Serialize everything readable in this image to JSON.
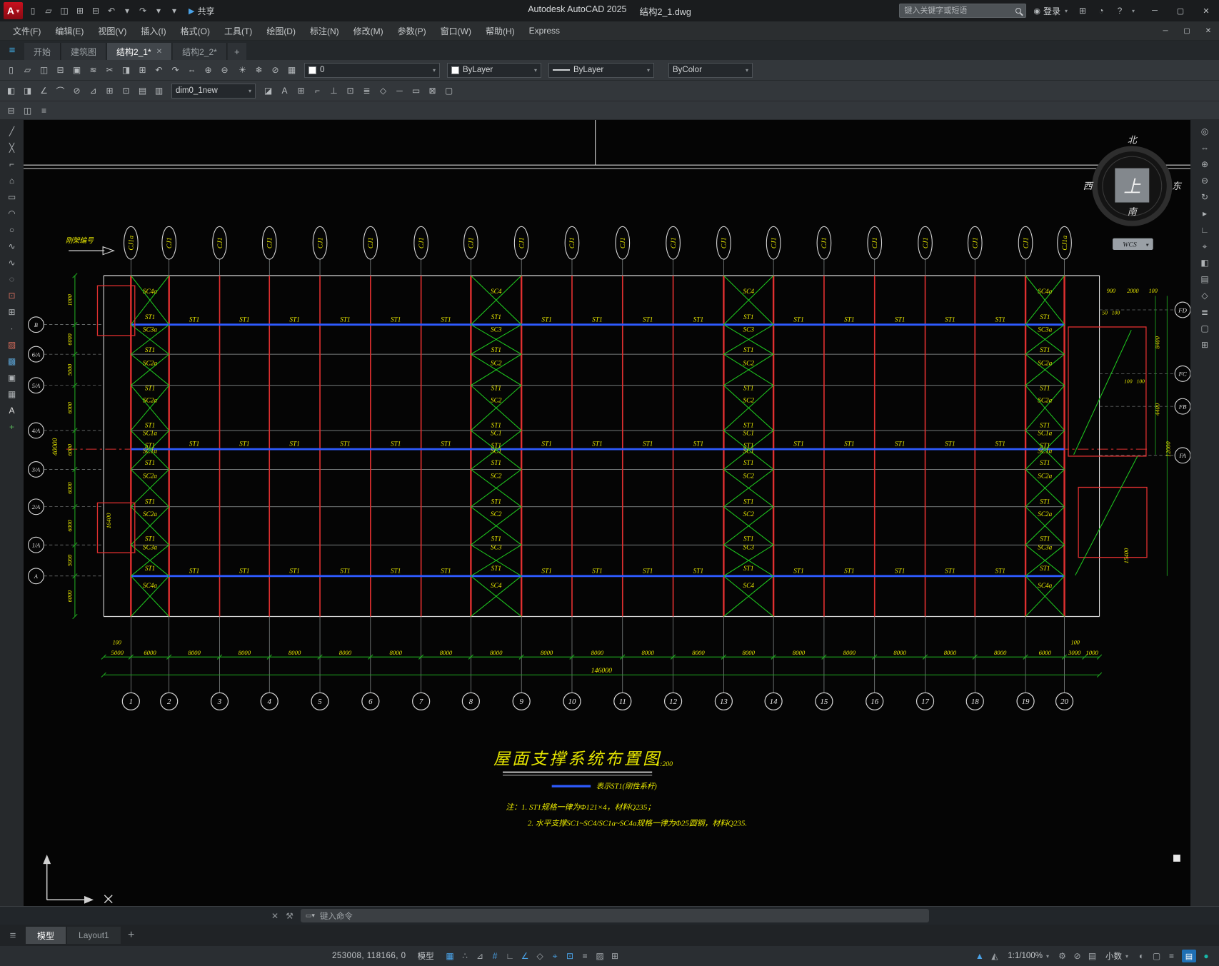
{
  "titlebar": {
    "logo": "A",
    "app_title": "Autodesk AutoCAD 2025",
    "doc_title": "结构2_1.dwg",
    "share_label": "共享",
    "search_placeholder": "键入关键字或短语",
    "login_label": "登录",
    "qat_icons": [
      {
        "name": "new-drawing-icon",
        "glyph": "▯"
      },
      {
        "name": "open-icon",
        "glyph": "▱"
      },
      {
        "name": "save-icon",
        "glyph": "◫"
      },
      {
        "name": "save-as-icon",
        "glyph": "⊞"
      },
      {
        "name": "plot-icon",
        "glyph": "⊟"
      },
      {
        "name": "undo-icon",
        "glyph": "↶"
      },
      {
        "name": "undo-dropdown-icon",
        "glyph": "▾"
      },
      {
        "name": "redo-icon",
        "glyph": "↷"
      },
      {
        "name": "redo-dropdown-icon",
        "glyph": "▾"
      },
      {
        "name": "qat-customize-icon",
        "glyph": "▾"
      }
    ]
  },
  "menubar": {
    "items": [
      "文件(F)",
      "编辑(E)",
      "视图(V)",
      "插入(I)",
      "格式(O)",
      "工具(T)",
      "绘图(D)",
      "标注(N)",
      "修改(M)",
      "参数(P)",
      "窗口(W)",
      "帮助(H)",
      "Express"
    ]
  },
  "filetabs": {
    "items": [
      {
        "label": "开始",
        "active": false
      },
      {
        "label": "建筑图",
        "active": false
      },
      {
        "label": "结构2_1*",
        "active": true,
        "closable": true
      },
      {
        "label": "结构2_2*",
        "active": false
      }
    ],
    "new_tab": "+"
  },
  "ribbon": {
    "layer_value": "0",
    "color_value": "ByLayer",
    "linetype_value": "ByLayer",
    "plotstyle_value": "ByColor",
    "dimstyle_value": "dim0_1new",
    "row1_icons_a": [
      {
        "name": "new-icon",
        "glyph": "▯"
      },
      {
        "name": "open-icon",
        "glyph": "▱"
      },
      {
        "name": "save-icon",
        "glyph": "◫"
      },
      {
        "name": "plot-icon",
        "glyph": "⊟"
      },
      {
        "name": "publish-icon",
        "glyph": "▣"
      },
      {
        "name": "match-properties-icon",
        "glyph": "≋"
      },
      {
        "name": "cut-icon",
        "glyph": "✂"
      },
      {
        "name": "copy-clip-icon",
        "glyph": "◨"
      },
      {
        "name": "paste-icon",
        "glyph": "⊞"
      },
      {
        "name": "undo-icon",
        "glyph": "↶"
      },
      {
        "name": "redo-icon",
        "glyph": "↷"
      },
      {
        "name": "pan-icon",
        "glyph": "⇔"
      },
      {
        "name": "zoom-in-icon",
        "glyph": "⊕"
      },
      {
        "name": "zoom-out-icon",
        "glyph": "⊖"
      }
    ],
    "row1_icons_b": [
      {
        "name": "layer-on-icon",
        "glyph": "☀"
      },
      {
        "name": "layer-freeze-icon",
        "glyph": "❄"
      },
      {
        "name": "layer-lock-icon",
        "glyph": "⊘"
      },
      {
        "name": "layer-properties-icon",
        "glyph": "▦"
      }
    ],
    "row2_icons_a": [
      {
        "name": "dim-linear-icon",
        "glyph": "◧"
      },
      {
        "name": "dim-aligned-icon",
        "glyph": "◨"
      },
      {
        "name": "dim-angular-icon",
        "glyph": "∠"
      },
      {
        "name": "dim-radius-icon",
        "glyph": "⌒"
      },
      {
        "name": "dim-diameter-icon",
        "glyph": "⊘"
      },
      {
        "name": "leader-icon",
        "glyph": "⊿"
      },
      {
        "name": "tolerance-icon",
        "glyph": "⊞"
      },
      {
        "name": "center-mark-icon",
        "glyph": "⊡"
      },
      {
        "name": "dim-edit-icon",
        "glyph": "▤"
      },
      {
        "name": "dim-update-icon",
        "glyph": "▥"
      }
    ],
    "row2_icons_b": [
      {
        "name": "dim-style-icon",
        "glyph": "◪"
      },
      {
        "name": "text-style-icon",
        "glyph": "A"
      },
      {
        "name": "table-icon",
        "glyph": "⊞"
      },
      {
        "name": "mleader-icon",
        "glyph": "⌐"
      },
      {
        "name": "ortho-icon",
        "glyph": "⊥"
      },
      {
        "name": "osnap-icon",
        "glyph": "⊡"
      },
      {
        "name": "layers-icon",
        "glyph": "≣"
      },
      {
        "name": "group-icon",
        "glyph": "◇"
      },
      {
        "name": "measure-icon",
        "glyph": "─"
      },
      {
        "name": "properties-icon",
        "glyph": "▭"
      },
      {
        "name": "blocks-icon",
        "glyph": "⊠"
      },
      {
        "name": "tool-palettes-icon",
        "glyph": "▢"
      }
    ],
    "row3_icons": [
      {
        "name": "layer-walk-icon",
        "glyph": "⊟"
      },
      {
        "name": "layer-merge-icon",
        "glyph": "◫"
      },
      {
        "name": "layer-translate-icon",
        "glyph": "≡"
      }
    ]
  },
  "left_toolbar": [
    {
      "name": "line-tool-icon",
      "glyph": "╱"
    },
    {
      "name": "construction-line-tool-icon",
      "glyph": "╳"
    },
    {
      "name": "polyline-tool-icon",
      "glyph": "⌐"
    },
    {
      "name": "polygon-tool-icon",
      "glyph": "⌂"
    },
    {
      "name": "rectangle-tool-icon",
      "glyph": "▭"
    },
    {
      "name": "arc-tool-icon",
      "glyph": "◠"
    },
    {
      "name": "circle-tool-icon",
      "glyph": "○"
    },
    {
      "name": "revision-cloud-tool-icon",
      "glyph": "∿"
    },
    {
      "name": "spline-tool-icon",
      "glyph": "∿"
    },
    {
      "name": "ellipse-tool-icon",
      "glyph": "◌"
    },
    {
      "name": "insert-block-tool-icon",
      "glyph": "⊡",
      "color": "#c86a5a"
    },
    {
      "name": "make-block-tool-icon",
      "glyph": "⊞"
    },
    {
      "name": "point-tool-icon",
      "glyph": "∙"
    },
    {
      "name": "hatch-tool-icon",
      "glyph": "▨",
      "color": "#d06a5a"
    },
    {
      "name": "gradient-tool-icon",
      "glyph": "▩",
      "color": "#5aa0d0"
    },
    {
      "name": "region-tool-icon",
      "glyph": "▣"
    },
    {
      "name": "table-tool-icon",
      "glyph": "▦"
    },
    {
      "name": "multiline-text-tool-icon",
      "glyph": "A",
      "color": "#e0e0e0"
    },
    {
      "name": "add-selected-tool-icon",
      "glyph": "+",
      "color": "#58b058"
    }
  ],
  "right_toolbar": [
    {
      "name": "navigation-wheel-icon",
      "glyph": "◎"
    },
    {
      "name": "pan-icon",
      "glyph": "⇔"
    },
    {
      "name": "zoom-extents-icon",
      "glyph": "⊕"
    },
    {
      "name": "zoom-window-icon",
      "glyph": "⊖"
    },
    {
      "name": "orbit-icon",
      "glyph": "↻"
    },
    {
      "name": "showmotion-icon",
      "glyph": "▸"
    },
    {
      "name": "ucs-icon",
      "glyph": "∟"
    },
    {
      "name": "measure-icon",
      "glyph": "⌖"
    },
    {
      "name": "section-icon",
      "glyph": "◧"
    },
    {
      "name": "view-manager-icon",
      "glyph": "▤"
    },
    {
      "name": "visual-style-icon",
      "glyph": "◇"
    },
    {
      "name": "layers-panel-icon",
      "glyph": "≣"
    },
    {
      "name": "properties-panel-icon",
      "glyph": "▢"
    },
    {
      "name": "sheet-set-icon",
      "glyph": "⊞"
    }
  ],
  "cmdbar": {
    "history_chip": "▭▾",
    "placeholder": "键入命令",
    "close_glyph": "✕",
    "tools_glyph": "⚒"
  },
  "doctabs": {
    "items": [
      {
        "label": "模型",
        "active": true
      },
      {
        "label": "Layout1",
        "active": false
      }
    ],
    "new_tab": "+"
  },
  "statusbar": {
    "coords": "253008, 118166, 0",
    "model_label": "模型",
    "scale_label": "1:1/100%",
    "units_label": "小数",
    "left_icons": [
      {
        "name": "grid-icon",
        "glyph": "▦",
        "active": true
      },
      {
        "name": "snap-mode-icon",
        "glyph": "∴"
      },
      {
        "name": "infer-constraints-icon",
        "glyph": "⊿"
      },
      {
        "name": "dynamic-input-icon",
        "glyph": "#",
        "active": true
      },
      {
        "name": "ortho-mode-icon",
        "glyph": "∟"
      },
      {
        "name": "polar-tracking-icon",
        "glyph": "∠",
        "active": true
      },
      {
        "name": "isometric-drafting-icon",
        "glyph": "◇"
      },
      {
        "name": "object-snap-tracking-icon",
        "glyph": "⌖",
        "active": true
      },
      {
        "name": "object-snap-icon",
        "glyph": "⊡",
        "active": true
      },
      {
        "name": "lineweight-icon",
        "glyph": "≡"
      },
      {
        "name": "transparency-icon",
        "glyph": "▨"
      },
      {
        "name": "selection-cycling-icon",
        "glyph": "⊞"
      }
    ],
    "right_icons_a": [
      {
        "name": "annotation-visibility-icon",
        "glyph": "▲",
        "active": true
      },
      {
        "name": "autoscale-icon",
        "glyph": "◭"
      }
    ],
    "right_icons_b": [
      {
        "name": "workspace-switching-icon",
        "glyph": "⚙"
      },
      {
        "name": "annotation-monitor-icon",
        "glyph": "⊘"
      },
      {
        "name": "quick-properties-icon",
        "glyph": "▤"
      }
    ],
    "right_icons_c": [
      {
        "name": "graphics-performance-icon",
        "glyph": "◐"
      },
      {
        "name": "clean-screen-icon",
        "glyph": "▢"
      },
      {
        "name": "customization-icon",
        "glyph": "≡"
      }
    ]
  },
  "drawing": {
    "frame_note": "刚架编号",
    "cj_labels": [
      "CJ1a",
      "CJ1",
      "CJ1",
      "CJ1",
      "CJ1",
      "CJ1",
      "CJ1",
      "CJ1",
      "CJ1",
      "CJ1",
      "CJ1",
      "CJ1",
      "CJ1",
      "CJ1",
      "CJ1",
      "CJ1",
      "CJ1",
      "CJ1",
      "CJ1",
      "CJ1a"
    ],
    "columns": [
      "1",
      "2",
      "3",
      "4",
      "5",
      "6",
      "7",
      "8",
      "9",
      "10",
      "11",
      "12",
      "13",
      "14",
      "15",
      "16",
      "17",
      "18",
      "19",
      "20"
    ],
    "row_bubbles": [
      "B",
      "6/A",
      "5/A",
      "4/A",
      "3/A",
      "2/A",
      "1/A",
      "A"
    ],
    "bottom_dims": [
      "5000",
      "6000",
      "8000",
      "8000",
      "8000",
      "8000",
      "8000",
      "8000",
      "8000",
      "8000",
      "8000",
      "8000",
      "8000",
      "8000",
      "8000",
      "8000",
      "8000",
      "8000",
      "8000",
      "6000",
      "3000",
      "1000"
    ],
    "total_dim": "146000",
    "offset_dim": "100",
    "left_dims": [
      "1000",
      "6000",
      "5000",
      "6000",
      "6000",
      "6000",
      "6000",
      "5000",
      "6000"
    ],
    "left_total": "40000",
    "left_aux_dim": "16400",
    "fa_labels": [
      "FD",
      "FC",
      "FB",
      "FA"
    ],
    "right_dims_top": [
      "900",
      "2000",
      "100"
    ],
    "right_small_dims": [
      "50",
      "100",
      "100",
      "100"
    ],
    "right_rot_dims": [
      "8400",
      "4400",
      "12000",
      "15400"
    ],
    "brace_labels_a": [
      "SC4a",
      "ST1",
      "SC3a",
      "ST1",
      "SC2a",
      "ST1",
      "SC2a",
      "ST1",
      "SC1a",
      "ST1",
      "SC1a",
      "ST1",
      "SC2a",
      "ST1",
      "SC2a",
      "ST1",
      "SC3a",
      "ST1",
      "SC4a"
    ],
    "brace_labels_m": [
      "SC4",
      "ST1",
      "SC3",
      "ST1",
      "SC2",
      "ST1",
      "SC2",
      "ST1",
      "SC1",
      "ST1",
      "SC1",
      "ST1",
      "SC2",
      "ST1",
      "SC2",
      "ST1",
      "SC3",
      "ST1",
      "SC4"
    ],
    "st_label": "ST1",
    "title": "屋面支撑系统布置图",
    "scale": "1:200",
    "legend": "表示ST1(刚性系杆)",
    "notes": [
      "注：1. ST1规格一律为Φ121×4，材料Q235；",
      "2. 水平支撑SC1~SC4/SC1a~SC4a规格一律为Φ25圆钢，材料Q235."
    ],
    "compass": {
      "n": "北",
      "s": "南",
      "w": "西",
      "e": "东",
      "center": "上"
    },
    "wcs": "WCS"
  }
}
